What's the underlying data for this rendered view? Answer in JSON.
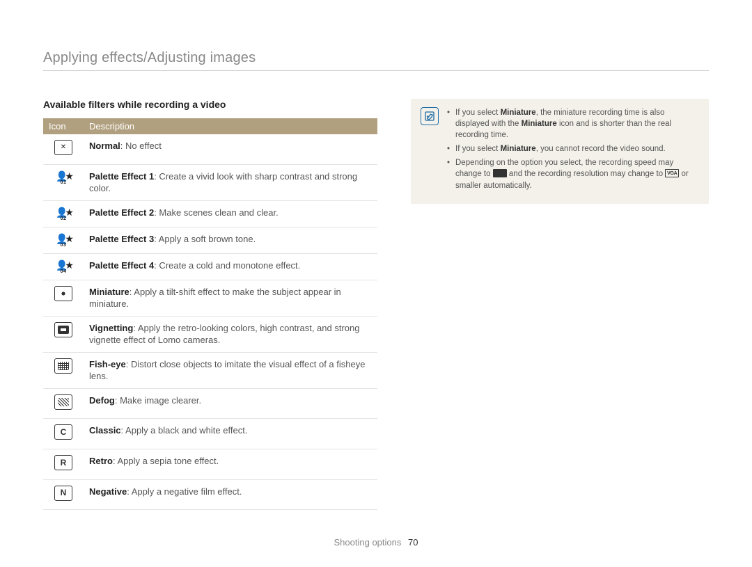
{
  "page_title": "Applying effects/Adjusting images",
  "section_title": "Available filters while recording a video",
  "table": {
    "headers": {
      "icon": "Icon",
      "desc": "Description"
    },
    "rows": [
      {
        "icon_type": "off",
        "name": "Normal",
        "desc": ": No effect"
      },
      {
        "icon_type": "p1",
        "name": "Palette Effect 1",
        "desc": ": Create a vivid look with sharp contrast and strong color."
      },
      {
        "icon_type": "p2",
        "name": "Palette Effect 2",
        "desc": ": Make scenes clean and clear."
      },
      {
        "icon_type": "p3",
        "name": "Palette Effect 3",
        "desc": ": Apply a soft brown tone."
      },
      {
        "icon_type": "p4",
        "name": "Palette Effect 4",
        "desc": ": Create a cold and monotone effect."
      },
      {
        "icon_type": "mini",
        "name": "Miniature",
        "desc": ": Apply a tilt-shift effect to make the subject appear in miniature."
      },
      {
        "icon_type": "vig",
        "name": "Vignetting",
        "desc": ": Apply the retro-looking colors, high contrast, and strong vignette effect of Lomo cameras."
      },
      {
        "icon_type": "fish",
        "name": "Fish-eye",
        "desc": ": Distort close objects to imitate the visual effect of a fisheye lens."
      },
      {
        "icon_type": "defog",
        "name": "Defog",
        "desc": ": Make image clearer."
      },
      {
        "icon_type": "classic",
        "name": "Classic",
        "desc": ": Apply a black and white effect."
      },
      {
        "icon_type": "retro",
        "name": "Retro",
        "desc": ": Apply a sepia tone effect."
      },
      {
        "icon_type": "neg",
        "name": "Negative",
        "desc": ": Apply a negative film effect."
      }
    ]
  },
  "notes": {
    "n1a": "If you select ",
    "n1b": "Miniature",
    "n1c": ", the miniature recording time is also displayed with the ",
    "n1d": "Miniature",
    "n1e": " icon and is shorter than the real recording time.",
    "n2a": "If you select ",
    "n2b": "Miniature",
    "n2c": ", you cannot record the video sound.",
    "n3a": "Depending on the option you select, the recording speed may change to ",
    "n3b": " and the recording resolution may change to ",
    "n3c": " or smaller automatically."
  },
  "footer": {
    "section": "Shooting options",
    "page": "70"
  },
  "icon_labels": {
    "off": "normal-off-icon",
    "p1": "palette-1-icon",
    "p2": "palette-2-icon",
    "p3": "palette-3-icon",
    "p4": "palette-4-icon",
    "mini": "miniature-icon",
    "vig": "vignetting-icon",
    "fish": "fisheye-icon",
    "defog": "defog-icon",
    "classic": "classic-icon",
    "retro": "retro-icon",
    "neg": "negative-icon"
  },
  "palette_subs": {
    "p1": "01",
    "p2": "02",
    "p3": "03",
    "p4": "04"
  }
}
